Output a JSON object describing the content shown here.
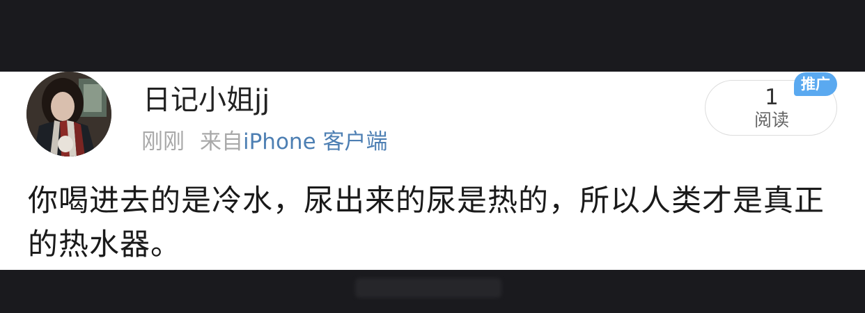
{
  "post": {
    "username": "日记小姐jj",
    "time": "刚刚",
    "source_prefix": "来自",
    "source_name": "iPhone 客户端",
    "body": "你喝进去的是冷水，尿出来的尿是热的，所以人类才是真正的热水器。"
  },
  "read_counter": {
    "count": "1",
    "label": "阅读"
  },
  "badge": {
    "label": "推广"
  },
  "colors": {
    "source_link": "#4d7fb3",
    "badge_bg": "#5aa9f0",
    "meta_text": "#a9a9a9"
  },
  "icons": {
    "avatar": "user-avatar-photo"
  }
}
